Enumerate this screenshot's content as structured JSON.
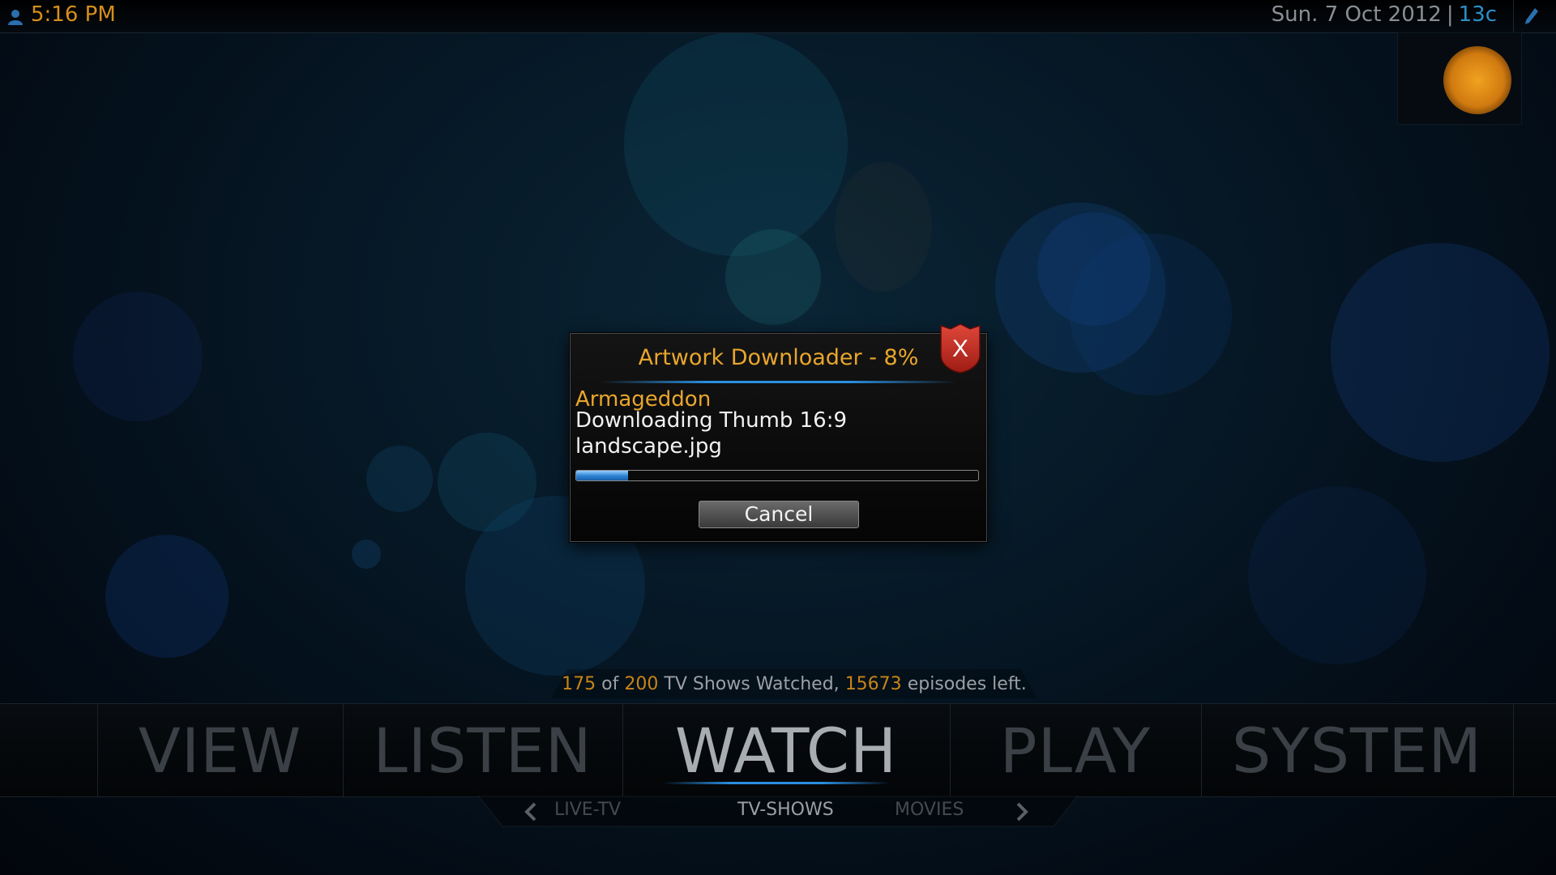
{
  "topbar": {
    "time": "5:16 PM",
    "date": "Sun. 7 Oct 2012",
    "separator": "|",
    "temperature": "13c",
    "icons": [
      "user-icon",
      "pencil-icon",
      "sun-weather-icon"
    ]
  },
  "dialog": {
    "title": "Artwork Downloader - 8%",
    "close_label": "X",
    "item_title": "Armageddon",
    "status": "Downloading Thumb 16:9",
    "filename": "landscape.jpg",
    "progress": 0.13,
    "cancel_label": "Cancel"
  },
  "stats": {
    "watched": "175",
    "of_text": "of",
    "total": "200",
    "middle_text": "TV Shows Watched,",
    "episodes": "15673",
    "end_text": "episodes left."
  },
  "menu": {
    "items": [
      {
        "label": "VIEW"
      },
      {
        "label": "LISTEN"
      },
      {
        "label": "WATCH"
      },
      {
        "label": "PLAY"
      },
      {
        "label": "SYSTEM"
      }
    ],
    "active": "WATCH"
  },
  "submenu": {
    "items": [
      {
        "label": "LIVE-TV"
      },
      {
        "label": "TV-SHOWS"
      },
      {
        "label": "MOVIES"
      }
    ],
    "active": "TV-SHOWS"
  },
  "colors": {
    "accent_orange": "#e9a62c",
    "accent_blue": "#2a8fe0",
    "close_red": "#c0281f"
  }
}
